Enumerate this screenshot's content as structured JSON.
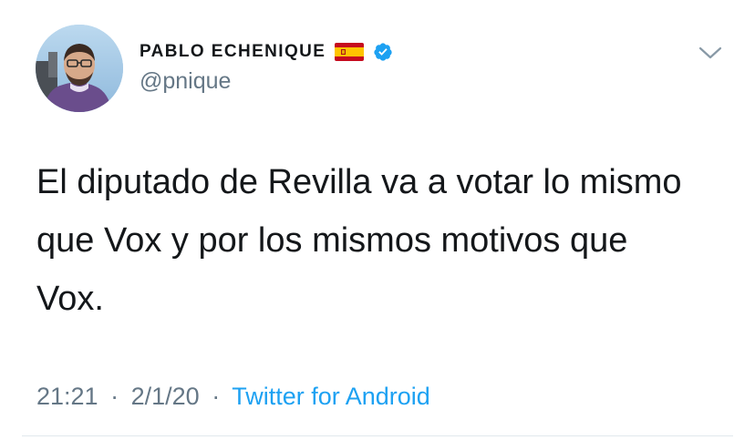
{
  "author": {
    "display_name": "PABLO ECHENIQUE",
    "handle": "@pnique",
    "avatar_icon": "profile-photo",
    "flag_icon": "spain-flag-emoji",
    "verified_icon": "verified-badge-icon",
    "verified_color": "#1da1f2"
  },
  "menu": {
    "caret_icon": "chevron-down-icon"
  },
  "tweet": {
    "text": "El diputado de Revilla va a votar lo mismo\nque Vox y por los mismos motivos que\nVox."
  },
  "meta": {
    "time": "21:21",
    "date": "2/1/20",
    "separator": "·",
    "source": "Twitter for Android"
  },
  "colors": {
    "text": "#14171a",
    "secondary": "#657786",
    "link": "#1da1f2",
    "divider": "#e1e8ed"
  }
}
